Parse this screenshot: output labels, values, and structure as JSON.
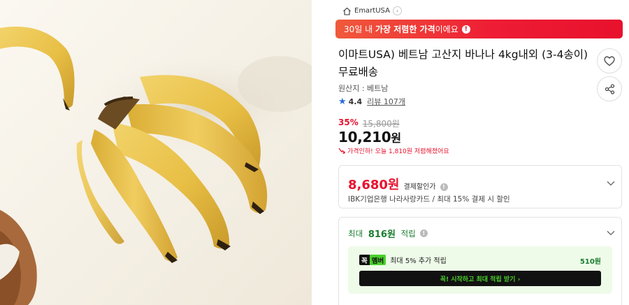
{
  "store": {
    "name": "EmartUSA",
    "icon": "house-icon"
  },
  "lowest_banner": {
    "prefix": "30일 내 ",
    "highlight": "가장 저렴한 가격",
    "suffix": "이에요",
    "info_glyph": "!",
    "color": "#e8112d"
  },
  "product": {
    "title": "이마트USA) 베트남 고산지 바나나 4kg내외 (3-4송이) 무료배송",
    "origin": "원산지 : 베트남",
    "rating_score": "4.4",
    "review_label": "리뷰 107개"
  },
  "pricing": {
    "discount_rate": "35%",
    "original_price": "15,800원",
    "price_number": "10,210",
    "price_unit": "원",
    "drop_text": "가격인하! 오늘 1,810원 저렴해졌어요"
  },
  "card_discount": {
    "amount": "8,680원",
    "tag": "결제할인가",
    "info_glyph": "!",
    "description": "IBK기업은행 나라사랑카드 / 최대 15% 결제 시 할인"
  },
  "points": {
    "prefix": "최대 ",
    "amount": "816원",
    "suffix": " 적립",
    "info_glyph": "!",
    "member": {
      "badge_a": "꼭",
      "badge_b": "멤버",
      "text": "최대 5% 추가 적립",
      "points": "510원",
      "cta": "꼭! 시작하고 최대 적립 받기 ›"
    }
  },
  "colors": {
    "accent_red": "#e8112d",
    "accent_green": "#1a7d2e",
    "member_green": "#4bd02c"
  }
}
